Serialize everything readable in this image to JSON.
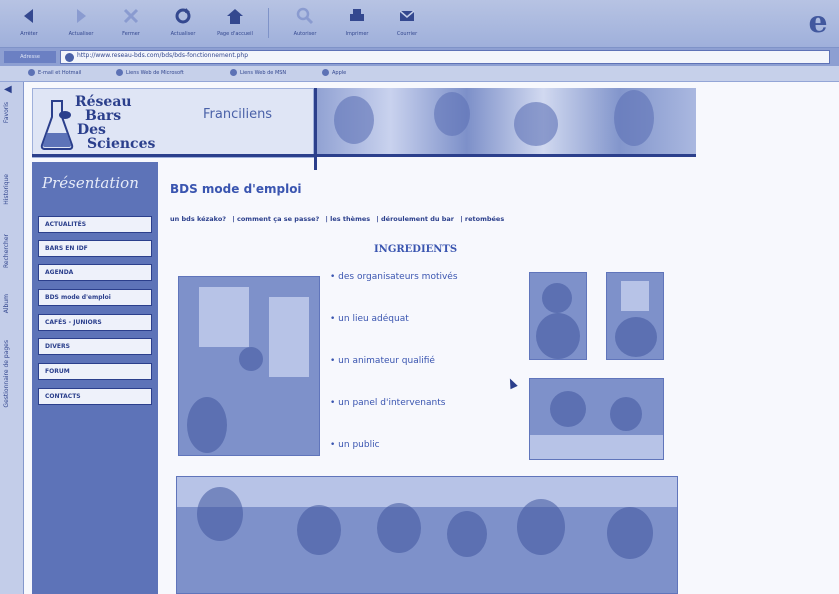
{
  "toolbar": {
    "buttons": [
      {
        "label": "Arrêter",
        "icon": "back-arrow-icon"
      },
      {
        "label": "Actualiser",
        "icon": "forward-arrow-icon"
      },
      {
        "label": "Fermer",
        "icon": "close-icon"
      },
      {
        "label": "Actualiser",
        "icon": "refresh-icon"
      },
      {
        "label": "Page d'accueil",
        "icon": "home-icon"
      },
      {
        "label": "Autoriser",
        "icon": "search-icon"
      },
      {
        "label": "Imprimer",
        "icon": "print-icon"
      },
      {
        "label": "Courrier",
        "icon": "mail-icon"
      }
    ]
  },
  "address": {
    "label": "Adresse",
    "url": "http://www.reseau-bds.com/bds/bds-fonctionnement.php"
  },
  "links": [
    "E-mail et Hotmail",
    "Liens Web de Microsoft",
    "Liens Web de MSN",
    "Apple"
  ],
  "explorer": {
    "tabs": [
      "Favoris",
      "Historique",
      "Rechercher",
      "Album",
      "Gestionnaire de pages"
    ]
  },
  "logo": {
    "line1": "Réseau",
    "line2": "Bars",
    "line3": "Des",
    "line4": "Sciences",
    "region": "Franciliens"
  },
  "sidenav": {
    "title": "Présentation",
    "items": [
      "ACTUALITÉS",
      "BARS EN IDF",
      "AGENDA",
      "BDS mode d'emploi",
      "CAFÉS - JUNIORS",
      "DIVERS",
      "FORUM",
      "CONTACTS"
    ]
  },
  "main": {
    "title": "BDS mode d'emploi",
    "subnav": [
      "un bds kézako?",
      "| comment ça se passe?",
      "| les thèmes",
      "| déroulement du bar",
      "| retombées"
    ],
    "ingredients_title": "INGREDIENTS",
    "ingredients": [
      "• des organisateurs motivés",
      "• un lieu adéquat",
      "• un animateur qualifié",
      "• un panel d'intervenants",
      "• un public"
    ]
  },
  "colors": {
    "accent": "#3a55b0",
    "nav_bg": "#5d73b8",
    "page_bg": "#f7f8fd"
  }
}
